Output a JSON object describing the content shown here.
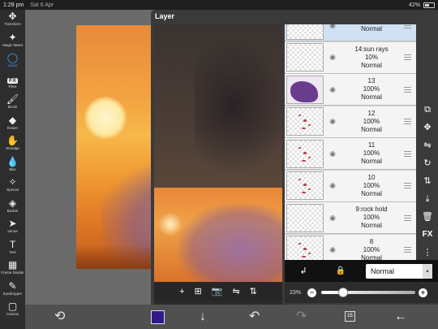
{
  "status_bar": {
    "time": "1:29 pm",
    "date": "Sat 6 Apr",
    "battery": "42%"
  },
  "tools": [
    {
      "name": "transform",
      "label": "Transform",
      "icon": "✥",
      "active": false
    },
    {
      "name": "magic-wand",
      "label": "Magic Wand",
      "icon": "✦",
      "active": false
    },
    {
      "name": "lasso",
      "label": "Lasso",
      "icon": "◯",
      "active": true
    },
    {
      "name": "filter",
      "label": "Filter",
      "icon": "FX",
      "active": false
    },
    {
      "name": "brush",
      "label": "Brush",
      "icon": "🖌",
      "active": false
    },
    {
      "name": "eraser",
      "label": "Eraser",
      "icon": "◆",
      "active": false
    },
    {
      "name": "smudge",
      "label": "Smudge",
      "icon": "✋",
      "active": false
    },
    {
      "name": "blur",
      "label": "Blur",
      "icon": "💧",
      "active": false
    },
    {
      "name": "special",
      "label": "Special",
      "icon": "✧",
      "active": false
    },
    {
      "name": "bucket",
      "label": "Bucket",
      "icon": "◈",
      "active": false
    },
    {
      "name": "vector",
      "label": "Vector",
      "icon": "➤",
      "active": false
    },
    {
      "name": "text",
      "label": "Text",
      "icon": "T",
      "active": false
    },
    {
      "name": "frame-divider",
      "label": "Frame Divider",
      "icon": "▦",
      "active": false
    },
    {
      "name": "eyedropper",
      "label": "Eyedropper",
      "icon": "✎",
      "active": false
    },
    {
      "name": "canvas",
      "label": "Canvas",
      "icon": "▢",
      "active": false
    }
  ],
  "layer_panel": {
    "title": "Layer",
    "layers": [
      {
        "name": "",
        "opacity": "23%",
        "mode": "Normal",
        "selected": true,
        "thumb": "checker"
      },
      {
        "name": "14:sun rays",
        "opacity": "10%",
        "mode": "Normal",
        "selected": false,
        "thumb": "checker"
      },
      {
        "name": "13",
        "opacity": "100%",
        "mode": "Normal",
        "selected": false,
        "thumb": "purple"
      },
      {
        "name": "12",
        "opacity": "100%",
        "mode": "Normal",
        "selected": false,
        "thumb": "marks"
      },
      {
        "name": "11",
        "opacity": "100%",
        "mode": "Normal",
        "selected": false,
        "thumb": "marks"
      },
      {
        "name": "10",
        "opacity": "100%",
        "mode": "Normal",
        "selected": false,
        "thumb": "marks"
      },
      {
        "name": "9:rock hold",
        "opacity": "100%",
        "mode": "Normal",
        "selected": false,
        "thumb": "checker"
      },
      {
        "name": "8",
        "opacity": "100%",
        "mode": "Normal",
        "selected": false,
        "thumb": "marks"
      }
    ],
    "blend_mode": "Normal",
    "opacity_label": "23%",
    "opacity_value": 0.23,
    "preview_tools": [
      "+",
      "⊞",
      "📷",
      "⇋",
      "⇅"
    ],
    "side_icons": [
      "checker",
      "⧉",
      "✥",
      "⇋",
      "↻",
      "⇅",
      "⤓",
      "🗑",
      "FX",
      "⋮"
    ]
  },
  "bottom_bar": {
    "color_hex": "#321a8b",
    "page_count": "15"
  }
}
